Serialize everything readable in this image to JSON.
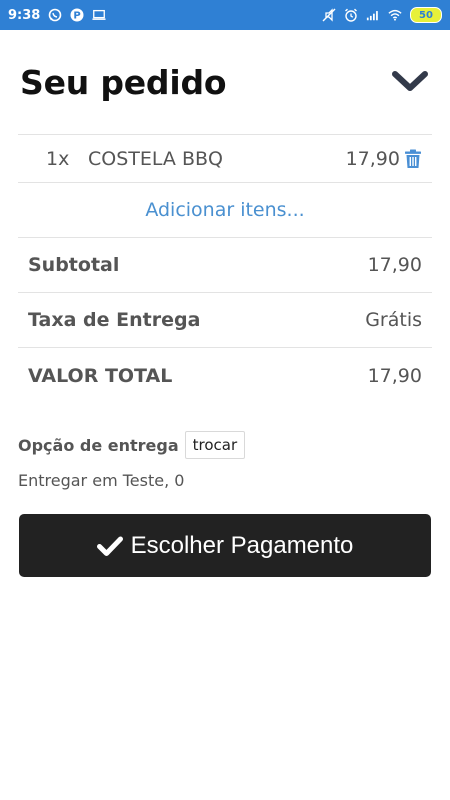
{
  "status_bar": {
    "time": "9:38",
    "battery": "50",
    "icons_left": [
      "whatsapp-icon",
      "p-icon",
      "laptop-icon"
    ],
    "icons_right": [
      "mute-icon",
      "alarm-icon",
      "signal-icon",
      "wifi-icon",
      "battery-icon"
    ]
  },
  "header": {
    "title": "Seu pedido",
    "collapse_icon": "chevron-down-icon"
  },
  "order": {
    "items": [
      {
        "qty": "1x",
        "name": "COSTELA BBQ",
        "price": "17,90"
      }
    ],
    "add_items_label": "Adicionar itens..."
  },
  "summary": {
    "subtotal_label": "Subtotal",
    "subtotal_value": "17,90",
    "delivery_fee_label": "Taxa de Entrega",
    "delivery_fee_value": "Grátis",
    "total_label": "VALOR TOTAL",
    "total_value": "17,90"
  },
  "delivery": {
    "option_label": "Opção de entrega",
    "change_label": "trocar",
    "address": "Entregar em Teste, 0"
  },
  "payment": {
    "button_label": "Escolher Pagamento"
  },
  "colors": {
    "status_bar": "#2f80d4",
    "link": "#4a90d0",
    "button_bg": "#222222"
  }
}
